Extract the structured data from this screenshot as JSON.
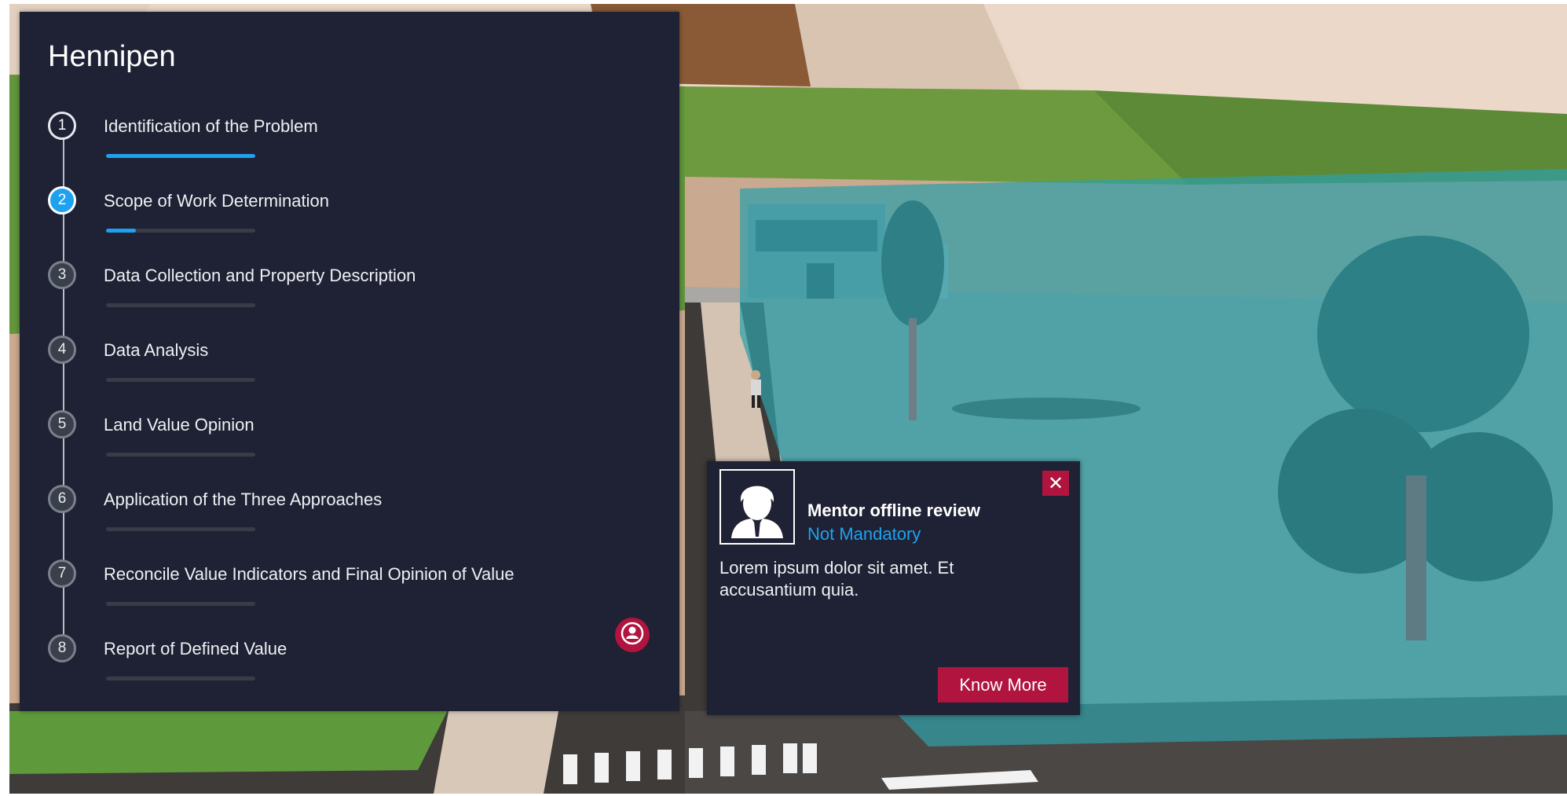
{
  "panel": {
    "title": "Hennipen",
    "steps": [
      {
        "number": "1",
        "label": "Identification of the Problem",
        "status": "done",
        "progress": 1.0
      },
      {
        "number": "2",
        "label": "Scope of Work Determination",
        "status": "active",
        "progress": 0.2
      },
      {
        "number": "3",
        "label": "Data Collection and Property Description",
        "status": "pending",
        "progress": 0
      },
      {
        "number": "4",
        "label": "Data Analysis",
        "status": "pending",
        "progress": 0
      },
      {
        "number": "5",
        "label": "Land Value Opinion",
        "status": "pending",
        "progress": 0
      },
      {
        "number": "6",
        "label": "Application of the Three Approaches",
        "status": "pending",
        "progress": 0
      },
      {
        "number": "7",
        "label": "Reconcile Value Indicators and Final Opinion of Value",
        "status": "pending",
        "progress": 0
      },
      {
        "number": "8",
        "label": "Report of Defined Value",
        "status": "pending",
        "progress": 0
      }
    ],
    "mentor_icon": "person-icon"
  },
  "popup": {
    "title": "Mentor offline review",
    "subtitle": "Not Mandatory",
    "body": "Lorem ipsum dolor sit amet. Et accusantium quia.",
    "button_label": "Know More",
    "close_label": "✕",
    "avatar_icon": "mentor-avatar-icon"
  },
  "colors": {
    "panel_bg": "#1f2234",
    "accent_blue": "#1ea2f0",
    "accent_crimson": "#b0143f"
  }
}
